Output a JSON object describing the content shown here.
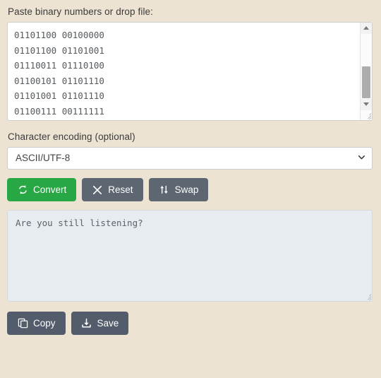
{
  "input_section": {
    "label": "Paste binary numbers or drop file:",
    "value": "01101100 00100000\n01101100 01101001\n01110011 01110100\n01100101 01101110\n01101001 01101110\n01100111 00111111",
    "scrollbar": {
      "up_arrow": "scroll-up-arrow",
      "down_arrow": "scroll-down-arrow"
    }
  },
  "encoding_section": {
    "label": "Character encoding (optional)",
    "selected": "ASCII/UTF-8"
  },
  "actions": {
    "convert": {
      "label": "Convert",
      "icon": "refresh-icon",
      "color": "#28a745"
    },
    "reset": {
      "label": "Reset",
      "icon": "close-icon",
      "color": "#5d6671"
    },
    "swap": {
      "label": "Swap",
      "icon": "swap-icon",
      "color": "#5d6671"
    }
  },
  "output_section": {
    "value": "Are you still listening?"
  },
  "output_actions": {
    "copy": {
      "label": "Copy",
      "icon": "copy-icon",
      "color": "#525c6b"
    },
    "save": {
      "label": "Save",
      "icon": "download-icon",
      "color": "#525c6b"
    }
  }
}
